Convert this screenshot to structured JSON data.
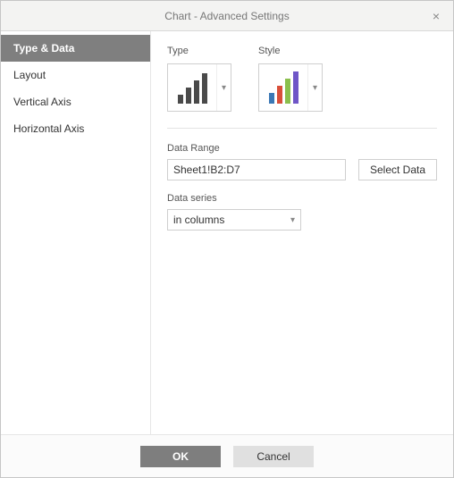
{
  "dialog_title": "Chart - Advanced Settings",
  "close_icon": "×",
  "sidebar": {
    "items": [
      {
        "label": "Type & Data",
        "active": true
      },
      {
        "label": "Layout",
        "active": false
      },
      {
        "label": "Vertical Axis",
        "active": false
      },
      {
        "label": "Horizontal Axis",
        "active": false
      }
    ]
  },
  "main": {
    "type_label": "Type",
    "style_label": "Style",
    "data_range_label": "Data Range",
    "data_range_value": "Sheet1!B2:D7",
    "select_data_label": "Select Data",
    "data_series_label": "Data series",
    "data_series_value": "in columns"
  },
  "footer": {
    "ok_label": "OK",
    "cancel_label": "Cancel"
  }
}
